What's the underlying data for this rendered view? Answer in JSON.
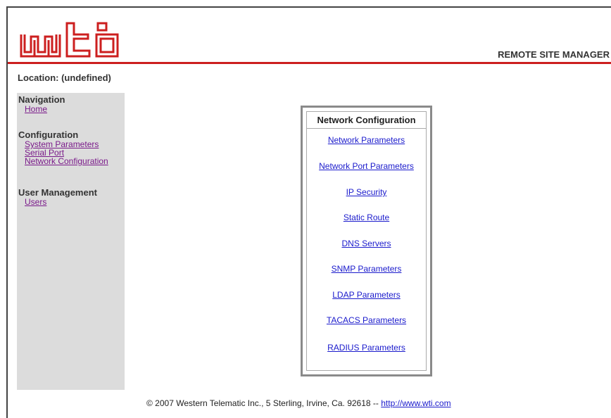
{
  "header": {
    "logo_text": "wti",
    "product_title": "REMOTE SITE MANAGER"
  },
  "location": "Location: (undefined)",
  "sidebar": {
    "sections": [
      {
        "heading": "Navigation",
        "links": [
          "Home"
        ]
      },
      {
        "heading": "Configuration",
        "links": [
          "System Parameters",
          "Serial Port",
          "Network Configuration"
        ]
      },
      {
        "heading": "User Management",
        "links": [
          "Users"
        ]
      }
    ]
  },
  "network_config": {
    "title": "Network Configuration",
    "links": [
      "Network Parameters",
      "Network Port Parameters",
      "IP Security",
      "Static Route",
      "DNS Servers",
      "SNMP Parameters",
      "LDAP Parameters",
      "TACACS Parameters",
      "RADIUS Parameters"
    ]
  },
  "footer": {
    "copyright": "© 2007 Western Telematic Inc., 5 Sterling, Irvine, Ca. 92618 -- ",
    "link": "http://www.wti.com"
  },
  "colors": {
    "brand_red": "#cc1f1f",
    "sidebar_bg": "#dcdcdc",
    "link_blue": "#1a1acc",
    "link_visited": "#7a1a8a"
  }
}
